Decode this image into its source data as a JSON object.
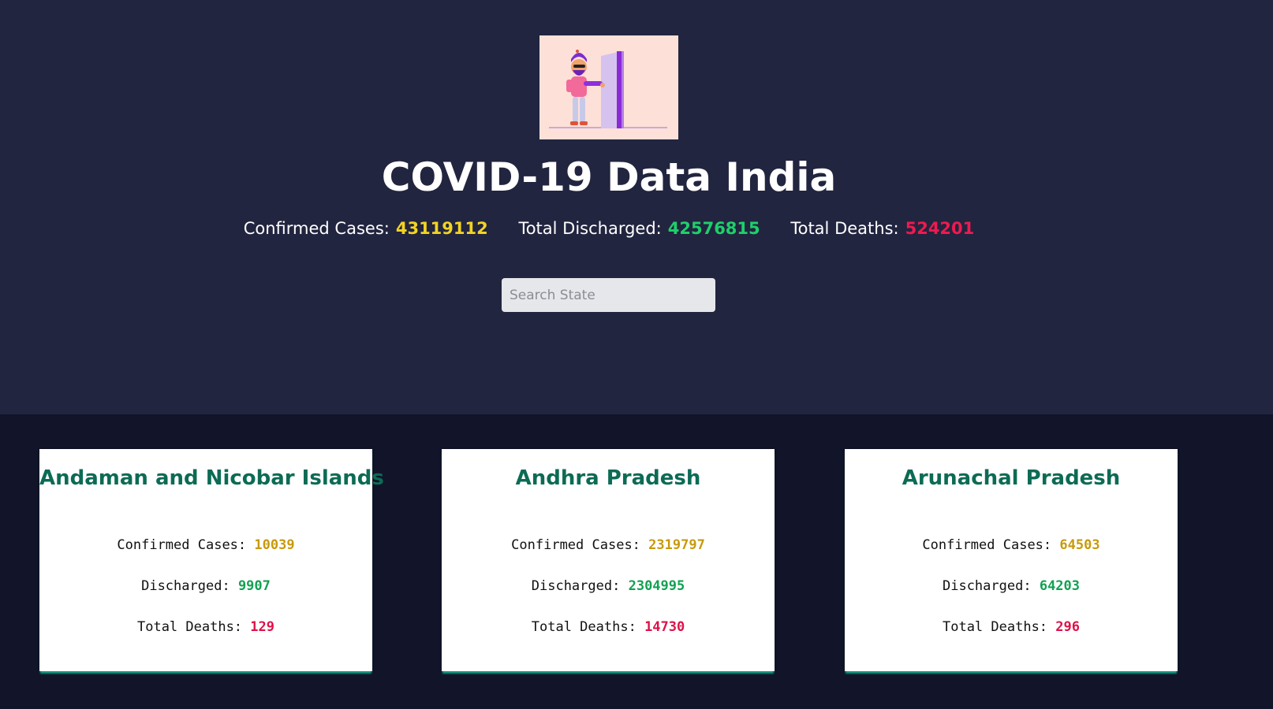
{
  "header": {
    "title": "COVID-19 Data India",
    "logo_icon": "illustration-person-opening-door-icon"
  },
  "totals": {
    "confirmed_label": "Confirmed Cases:",
    "confirmed_value": "43119112",
    "discharged_label": "Total Discharged:",
    "discharged_value": "42576815",
    "deaths_label": "Total Deaths:",
    "deaths_value": "524201"
  },
  "search": {
    "placeholder": "Search State",
    "value": ""
  },
  "colors": {
    "hero_background": "#22253f",
    "page_background": "#121429",
    "confirmed": "#f2d422",
    "discharged": "#1fcf6b",
    "deaths": "#ee1a4f",
    "state_title": "#0c6b55",
    "card_accent": "#16a085"
  },
  "states": [
    {
      "name": "Andaman and Nicobar Islands",
      "confirmed_label": "Confirmed Cases:",
      "confirmed": "10039",
      "discharged_label": "Discharged:",
      "discharged": "9907",
      "deaths_label": "Total Deaths:",
      "deaths": "129"
    },
    {
      "name": "Andhra Pradesh",
      "confirmed_label": "Confirmed Cases:",
      "confirmed": "2319797",
      "discharged_label": "Discharged:",
      "discharged": "2304995",
      "deaths_label": "Total Deaths:",
      "deaths": "14730"
    },
    {
      "name": "Arunachal Pradesh",
      "confirmed_label": "Confirmed Cases:",
      "confirmed": "64503",
      "discharged_label": "Discharged:",
      "discharged": "64203",
      "deaths_label": "Total Deaths:",
      "deaths": "296"
    }
  ]
}
